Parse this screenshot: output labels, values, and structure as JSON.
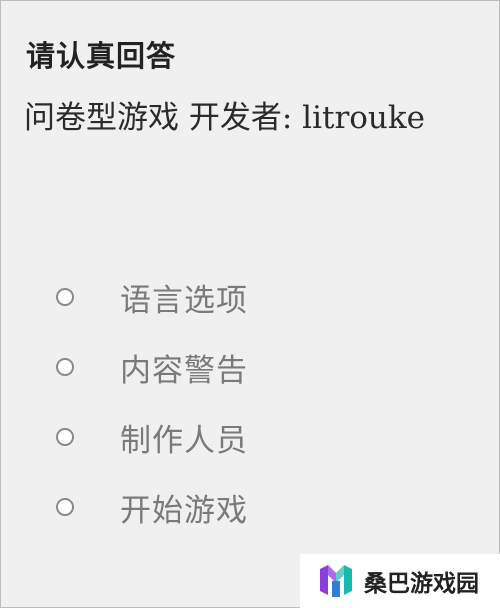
{
  "header": {
    "title": "请认真回答",
    "subtitle": "问卷型游戏 开发者: litrouke"
  },
  "menu": {
    "items": [
      {
        "label": "语言选项",
        "icon": "radio-circle-icon"
      },
      {
        "label": "内容警告",
        "icon": "radio-circle-icon"
      },
      {
        "label": "制作人员",
        "icon": "radio-circle-icon"
      },
      {
        "label": "开始游戏",
        "icon": "radio-circle-icon"
      }
    ]
  },
  "watermark": {
    "text": "桑巴游戏园",
    "icon": "site-logo-icon"
  },
  "colors": {
    "background": "#f0f0f0",
    "title_text": "#222222",
    "menu_text": "#7a7a7a",
    "radio_border": "#8a8a8a",
    "logo_purple": "#8b3fd9",
    "logo_teal": "#19b8b0"
  }
}
